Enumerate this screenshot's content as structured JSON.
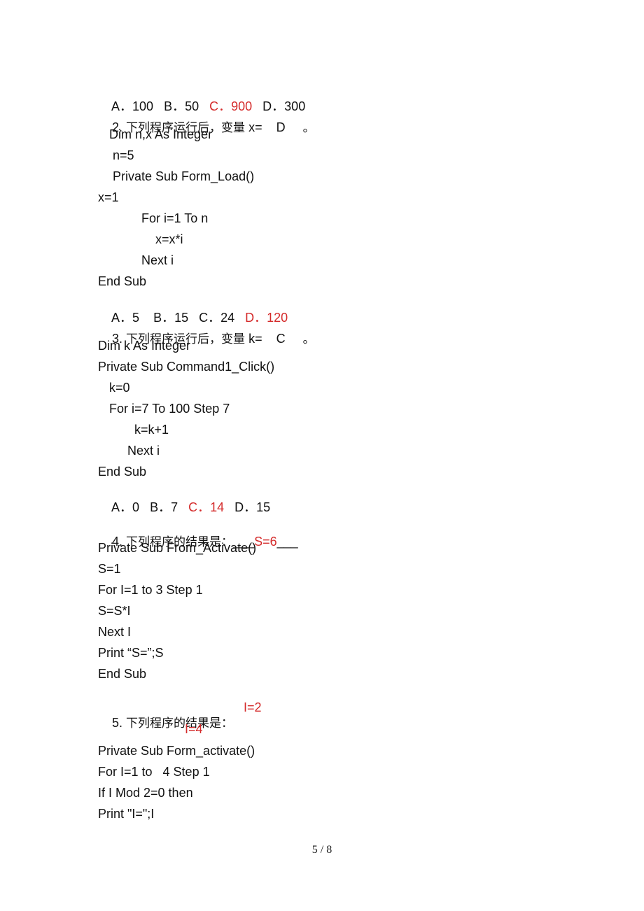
{
  "page_number": "5 / 8",
  "q1_options": {
    "a": "A．100",
    "b": "B．50",
    "c": "C．900",
    "d": "D．300",
    "answer": "c"
  },
  "q2": {
    "number": "2.",
    "prompt": "下列程序运行后，变量",
    "var": "x=",
    "answer": "D",
    "end": "。",
    "code": [
      "Dim n,x As Integer",
      "n=5",
      "Private Sub Form_Load()",
      "x=1",
      "For i=1 To n",
      "x=x*i",
      "Next i",
      "End Sub"
    ],
    "options": {
      "a": "A．5",
      "b": "B．15",
      "c": "C．24",
      "d": "D．120"
    }
  },
  "q3": {
    "number": "3.",
    "prompt": "下列程序运行后，变量",
    "var": "k=",
    "answer": "C",
    "end": "。",
    "code": [
      "Dim k As Integer",
      "Private Sub Command1_Click()",
      "k=0",
      "For i=7 To 100 Step 7",
      "k=k+1",
      "Next i",
      "End Sub"
    ],
    "options": {
      "a": "A．0",
      "b": "B．7",
      "c": "C．14",
      "d": "D．15"
    }
  },
  "q4": {
    "number": "4.",
    "prompt": "下列程序的结果是：",
    "blank_pre": "___",
    "answer": "S=6",
    "blank_post": "___",
    "code": [
      "Private Sub From_Activate()",
      "S=1",
      "For I=1 to 3 Step 1",
      "S=S*I",
      "Next I",
      "Print “S=”;S",
      "End Sub"
    ]
  },
  "q5": {
    "number": "5.",
    "prompt": "下列程序的结果是：",
    "answer_lines": [
      "I=2",
      "I=4"
    ],
    "code": [
      "Private Sub Form_activate()",
      "For I=1 to   4 Step 1",
      "If I Mod 2=0 then",
      "Print \"I=\";I"
    ]
  }
}
